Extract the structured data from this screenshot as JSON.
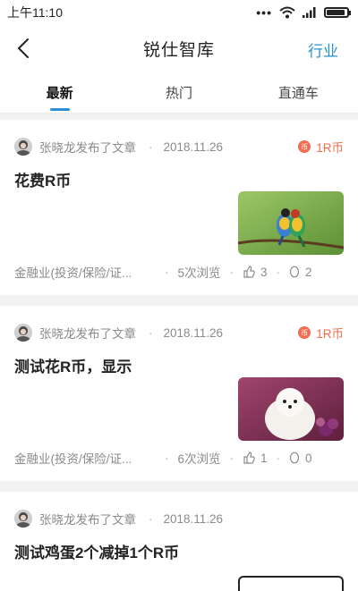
{
  "status_bar": {
    "time": "上午11:10",
    "dots": "•••",
    "battery_level": 0.9
  },
  "header": {
    "title": "锐仕智库",
    "action_label": "行业"
  },
  "tabs": [
    {
      "label": "最新",
      "active": true
    },
    {
      "label": "热门",
      "active": false
    },
    {
      "label": "直通车",
      "active": false
    }
  ],
  "posts": [
    {
      "author_line": "张晓龙发布了文章",
      "date": "2018.11.26",
      "reward": "1R币",
      "coin_label": "币",
      "title": "花费R币",
      "image": "birds-on-branch",
      "category": "金融业(投资/保险/证...",
      "views": "5次浏览",
      "likes": "3",
      "comments": "2"
    },
    {
      "author_line": "张晓龙发布了文章",
      "date": "2018.11.26",
      "reward": "1R币",
      "coin_label": "币",
      "title": "测试花R币，显示",
      "image": "white-dog",
      "category": "金融业(投资/保险/证...",
      "views": "6次浏览",
      "likes": "1",
      "comments": "0"
    },
    {
      "author_line": "张晓龙发布了文章",
      "date": "2018.11.26",
      "title": "测试鸡蛋2个减掉1个R币",
      "image": "sketch-drawing"
    }
  ],
  "separator": "·",
  "colors": {
    "accent": "#2b8fd6",
    "reward": "#f26c4f",
    "muted": "#8a8a8a"
  }
}
